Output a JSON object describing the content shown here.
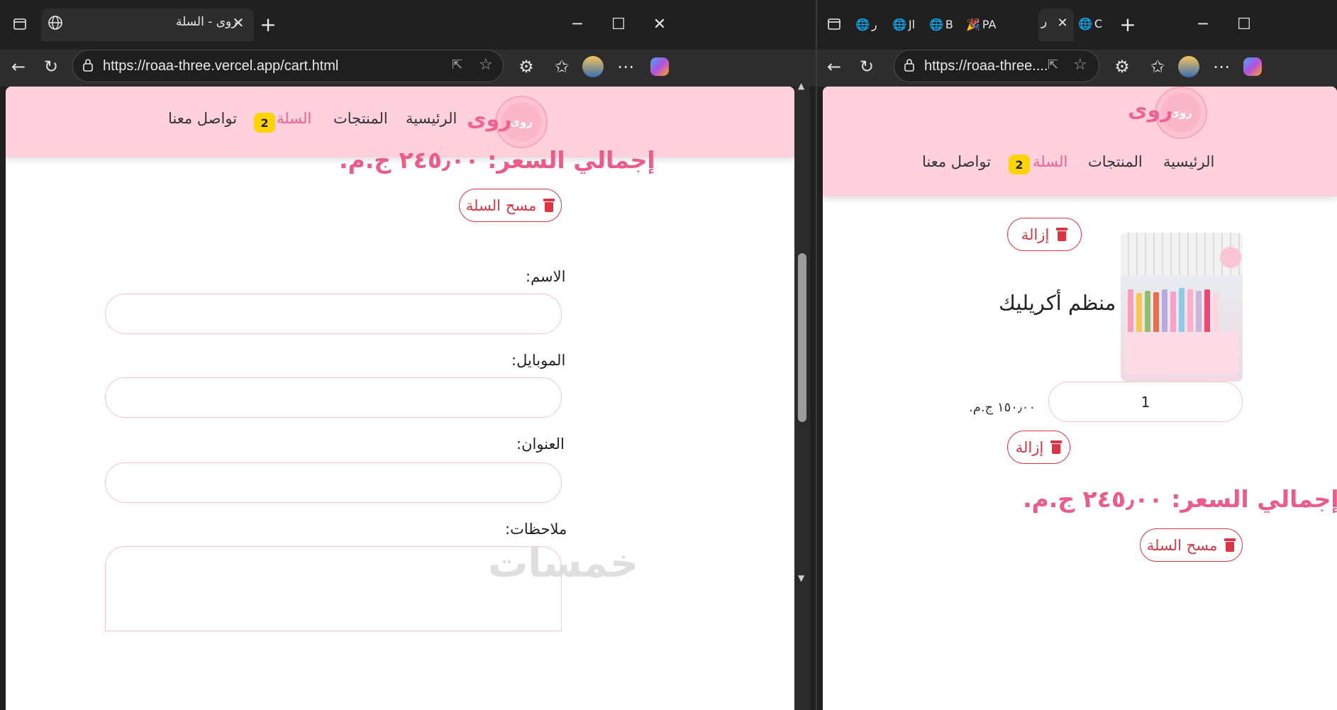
{
  "left_window": {
    "tab_title": "روى - السلة",
    "url": "https://roaa-three.vercel.app/cart.html",
    "site": {
      "brand": "روى",
      "logo_text": "روى",
      "nav": [
        {
          "label": "الرئيسية"
        },
        {
          "label": "المنتجات"
        },
        {
          "label": "السلة",
          "badge": "2"
        },
        {
          "label": "تواصل معنا"
        }
      ]
    },
    "cart": {
      "total": "إجمالي السعر: ٢٤٥٫٠٠ ج.م.",
      "clear_label": "مسح السلة"
    },
    "form": {
      "name_label": "الاسم:",
      "mobile_label": "الموبايل:",
      "address_label": "العنوان:",
      "notes_label": "ملاحظات:"
    },
    "watermark": "خمسات"
  },
  "right_window": {
    "tab_titles": [
      "ر",
      "Jl",
      "B",
      "PA",
      "ر",
      "C"
    ],
    "url": "https://roaa-three....",
    "site": {
      "brand": "روى",
      "logo_text": "روى",
      "nav": [
        {
          "label": "الرئيسية"
        },
        {
          "label": "المنتجات"
        },
        {
          "label": "السلة",
          "badge": "2"
        },
        {
          "label": "تواصل معنا"
        }
      ]
    },
    "cart": {
      "remove_label": "إزالة",
      "item": {
        "name": "منظم أكريليك",
        "quantity": "1",
        "price": "١٥٠٫٠٠ ج.م."
      },
      "total": "إجمالي السعر: ٢٤٥٫٠٠ ج.م.",
      "clear_label": "مسح السلة"
    }
  },
  "colors": {
    "header_bg": "#ffd1dc",
    "brand_pink": "#f06292",
    "danger": "#dc3545",
    "badge": "#ffd400"
  },
  "icons": [
    "sidebar-icon",
    "globe-icon",
    "close-icon",
    "plus-icon",
    "minimize-icon",
    "maximize-icon",
    "back-icon",
    "reload-icon",
    "lock-icon",
    "share-icon",
    "star-icon",
    "extensions-icon",
    "favorites-icon",
    "menu-icon",
    "copilot-icon",
    "trash-icon"
  ]
}
